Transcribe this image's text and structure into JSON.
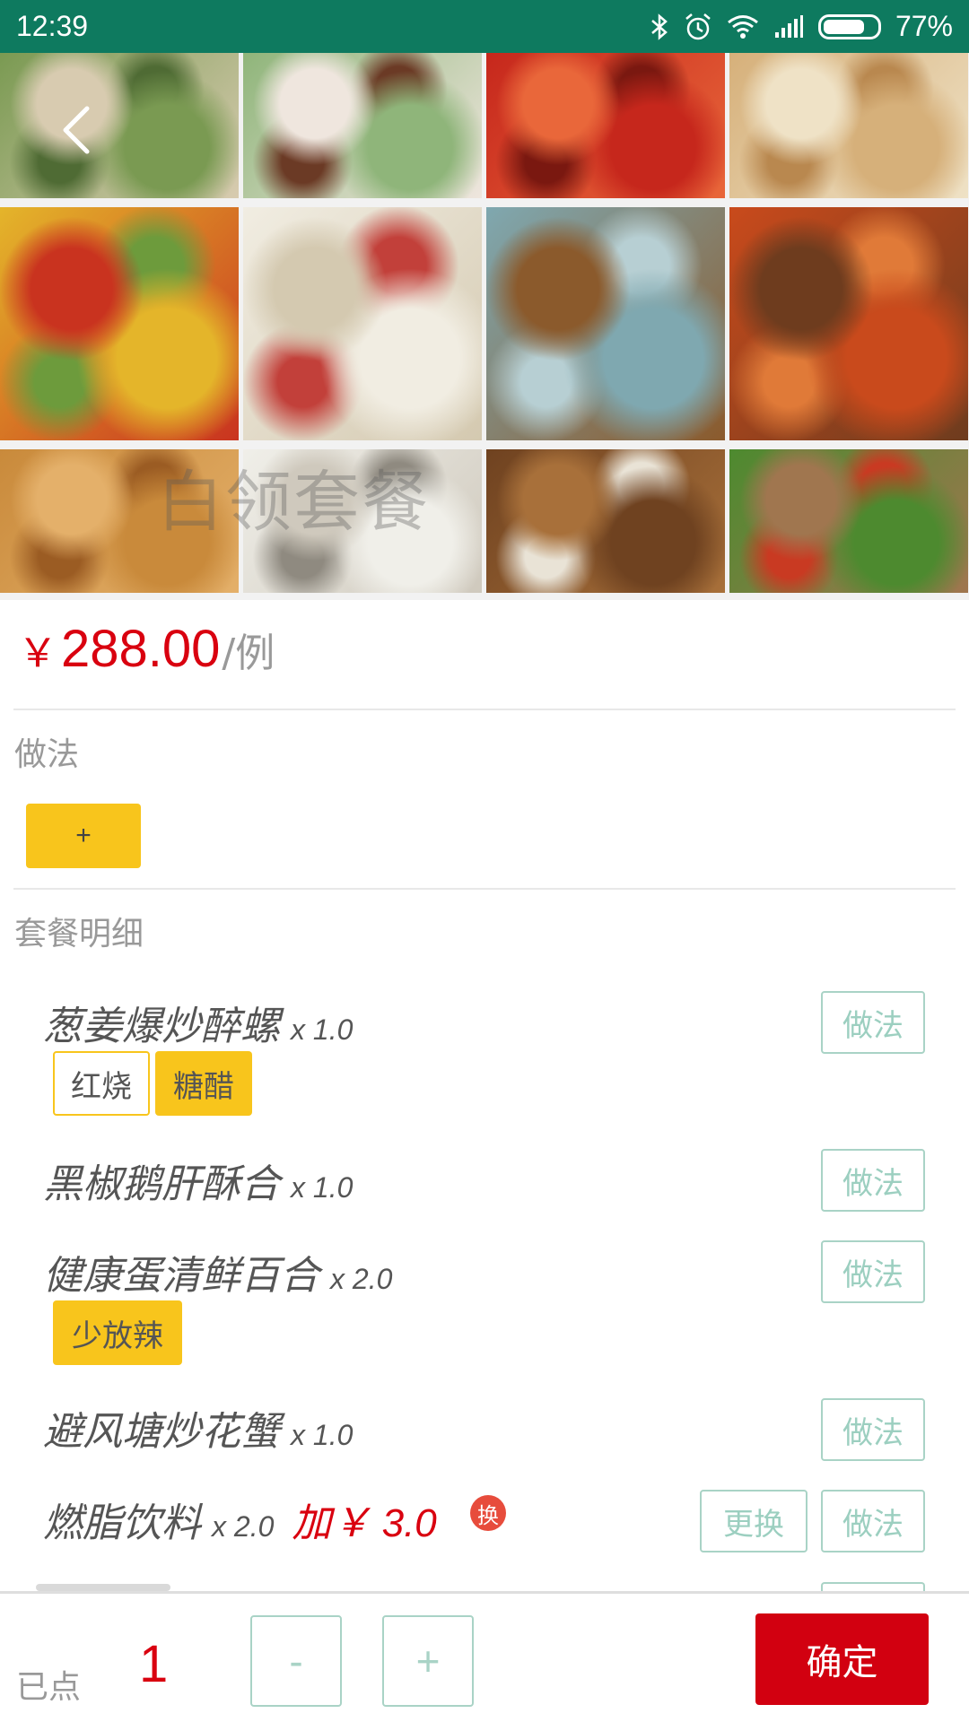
{
  "status_bar": {
    "time": "12:39",
    "battery_percent": "77%",
    "battery_level": 0.77
  },
  "header": {
    "watermark_text": "白领套餐"
  },
  "photos": [
    {
      "name": "photo-stuffed-bitter-melon",
      "colors": [
        "#7a9a52",
        "#d8cbb0",
        "#4f6b34"
      ]
    },
    {
      "name": "photo-dumpling-dish",
      "colors": [
        "#8fb57a",
        "#efe6de",
        "#6b3a25"
      ]
    },
    {
      "name": "photo-chili-stir-fry",
      "colors": [
        "#c6271c",
        "#e9673a",
        "#7a1810"
      ]
    },
    {
      "name": "photo-fried-balls",
      "colors": [
        "#d6b07a",
        "#efe2c6",
        "#b9884f"
      ]
    },
    {
      "name": "photo-stuffed-peppers",
      "colors": [
        "#e4b52a",
        "#c9331f",
        "#6d9b3c"
      ]
    },
    {
      "name": "photo-bird-nest-soup",
      "colors": [
        "#f1ede2",
        "#d4c9b0",
        "#c2403a"
      ]
    },
    {
      "name": "photo-abalone-plate",
      "colors": [
        "#7fa8b0",
        "#8b5a2c",
        "#b7cfd3"
      ]
    },
    {
      "name": "photo-crab-dish",
      "colors": [
        "#c94a1c",
        "#6e3c1e",
        "#e07a38"
      ]
    },
    {
      "name": "photo-fried-cakes",
      "colors": [
        "#c98a3b",
        "#e4b06a",
        "#9b5c23"
      ]
    },
    {
      "name": "photo-soup-bowl",
      "colors": [
        "#f0efe9",
        "#cfc9bd",
        "#8f8a80"
      ]
    },
    {
      "name": "photo-braised-fish",
      "colors": [
        "#6f4220",
        "#a8703a",
        "#e9e3d6"
      ]
    },
    {
      "name": "photo-beans-stir-fry",
      "colors": [
        "#4d8a2f",
        "#a0764f",
        "#c93a22"
      ]
    }
  ],
  "price": {
    "currency": "￥",
    "value": "288.00",
    "unit": "/例"
  },
  "method_section": {
    "label": "做法",
    "add_label": "+"
  },
  "set_details": {
    "label": "套餐明细",
    "items": [
      {
        "name": "葱姜爆炒醉螺",
        "qty": "x 1.0",
        "tags": [
          {
            "label": "红烧",
            "style": "outline"
          },
          {
            "label": "糖醋",
            "style": "filled"
          }
        ],
        "method_label": "做法"
      },
      {
        "name": "黑椒鹅肝酥合",
        "qty": "x 1.0",
        "tags": [],
        "method_label": "做法"
      },
      {
        "name": "健康蛋清鲜百合",
        "qty": "x 2.0",
        "tags": [
          {
            "label": "少放辣",
            "style": "filled"
          }
        ],
        "method_label": "做法"
      },
      {
        "name": "避风塘炒花蟹",
        "qty": "x 1.0",
        "tags": [],
        "method_label": "做法"
      },
      {
        "name": "燃脂饮料",
        "qty": "x 2.0",
        "extra_price": "加￥ 3.0",
        "swap_badge": "换",
        "replace_label": "更换",
        "method_label": "做法"
      }
    ]
  },
  "bottom_bar": {
    "ordered_label": "已点",
    "ordered_count": "1",
    "minus_label": "-",
    "plus_label": "+",
    "confirm_label": "确定"
  },
  "colors": {
    "status_bar": "#0e7a5f",
    "price_red": "#d9000f",
    "tag_yellow": "#f8c51c",
    "outline_green": "#a9d3c6",
    "confirm_red": "#d20010"
  }
}
